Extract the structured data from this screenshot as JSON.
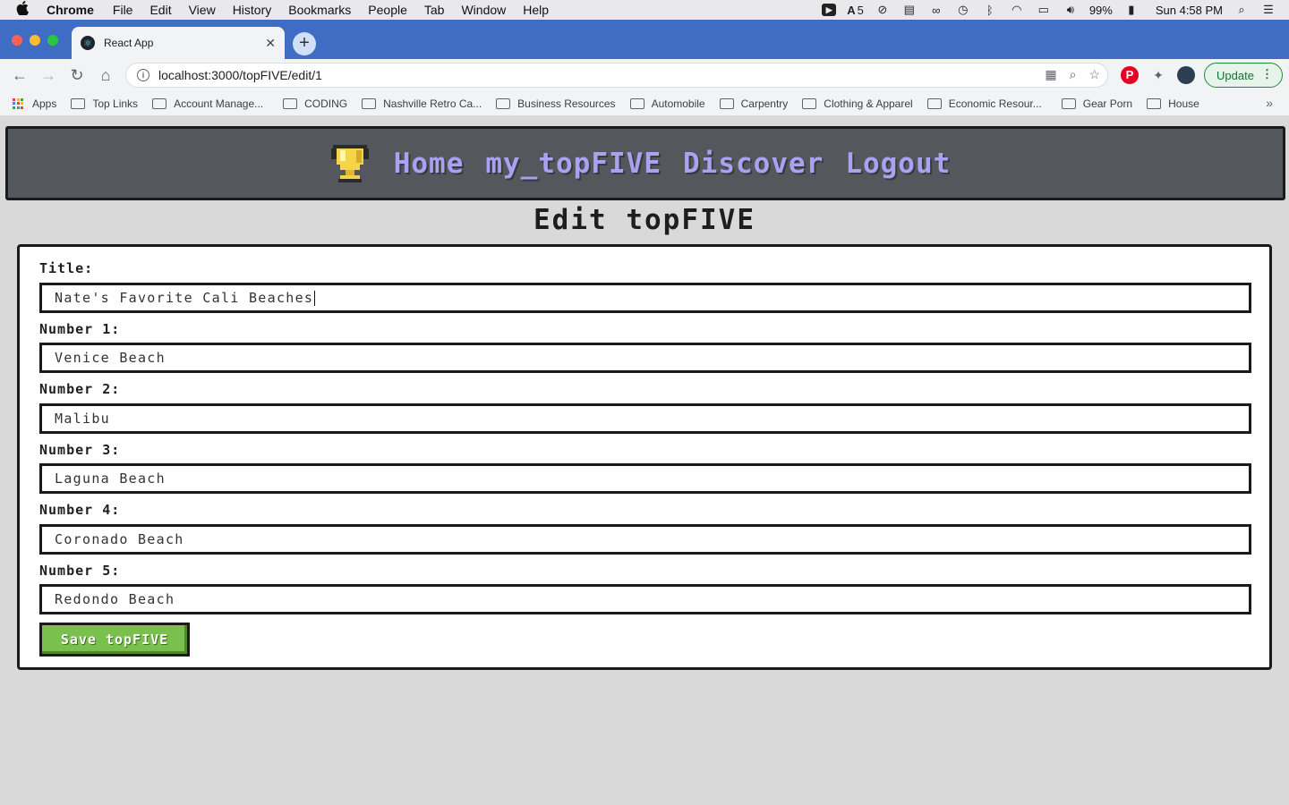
{
  "menubar": {
    "apple": "",
    "app_name": "Chrome",
    "items": [
      "File",
      "Edit",
      "View",
      "History",
      "Bookmarks",
      "People",
      "Tab",
      "Window",
      "Help"
    ],
    "tray_badge": "5",
    "battery": "99%",
    "clock": "Sun 4:58 PM"
  },
  "browser": {
    "tab_title": "React App",
    "url": "localhost:3000/topFIVE/edit/1",
    "update_label": "Update"
  },
  "bookmarks": {
    "apps_label": "Apps",
    "items": [
      "Top Links",
      "Account Manage...",
      "CODING",
      "Nashville Retro Ca...",
      "Business Resources",
      "Automobile",
      "Carpentry",
      "Clothing & Apparel",
      "Economic Resour...",
      "Gear Porn",
      "House"
    ]
  },
  "app": {
    "nav": {
      "home": "Home",
      "my_topfive": "my_topFIVE",
      "discover": "Discover",
      "logout": "Logout"
    },
    "page_title": "Edit topFIVE",
    "form": {
      "title_label": "Title:",
      "title_value": "Nate's Favorite Cali Beaches",
      "numbers": [
        {
          "label": "Number 1:",
          "value": "Venice Beach"
        },
        {
          "label": "Number 2:",
          "value": "Malibu"
        },
        {
          "label": "Number 3:",
          "value": "Laguna Beach"
        },
        {
          "label": "Number 4:",
          "value": "Coronado Beach"
        },
        {
          "label": "Number 5:",
          "value": "Redondo Beach"
        }
      ],
      "save_label": "Save topFIVE"
    }
  },
  "colors": {
    "nav_bg": "#54575b",
    "nav_link": "#a9a2f2",
    "save_green": "#7ac04f",
    "page_bg": "#d9d9d9"
  }
}
